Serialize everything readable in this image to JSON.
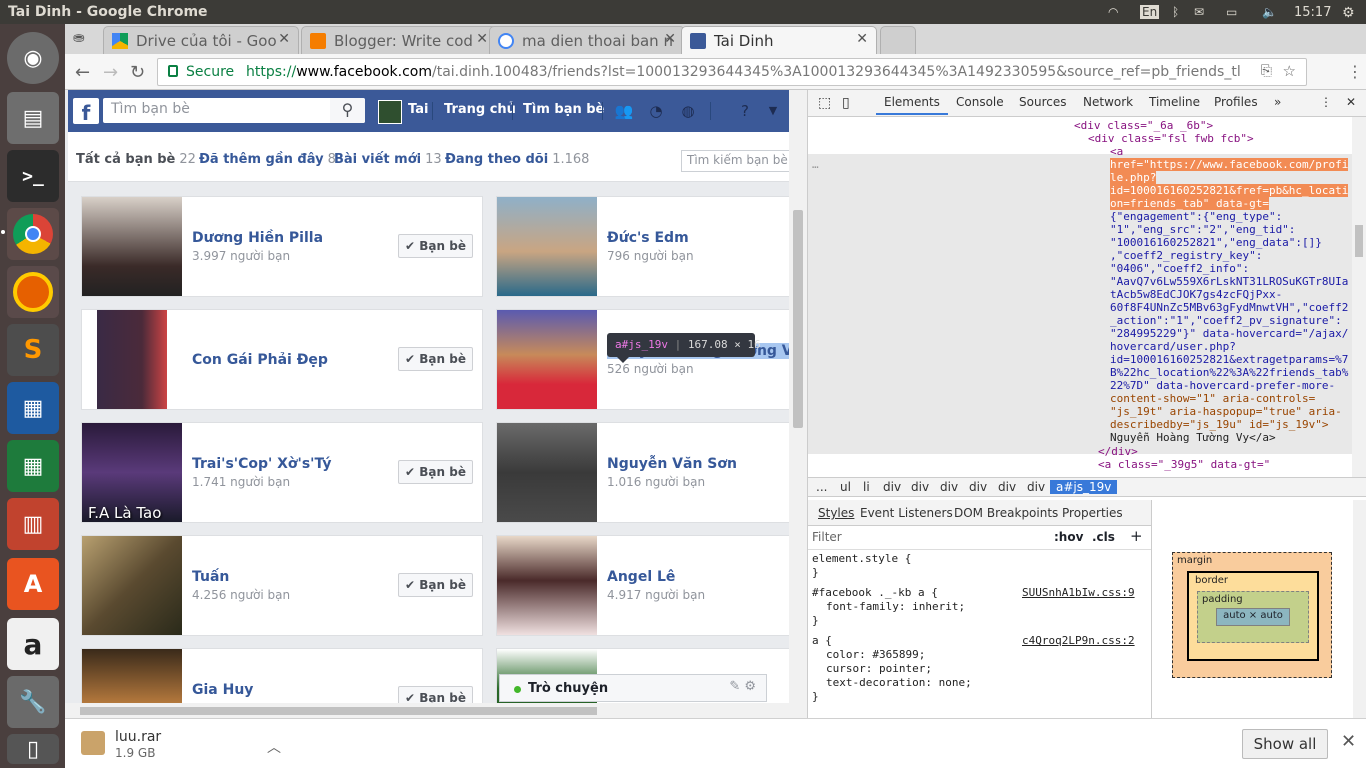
{
  "system": {
    "window_title": "Tai Dinh - Google Chrome",
    "kbd_layout": "En",
    "clock": "15:17"
  },
  "tabs": [
    {
      "label": "Drive của tôi - Goo",
      "active": false
    },
    {
      "label": "Blogger: Write cod",
      "active": false
    },
    {
      "label": "ma dien thoai ban n",
      "active": false
    },
    {
      "label": "Tai Dinh",
      "active": true
    }
  ],
  "omnibox": {
    "secure_label": "Secure",
    "url_scheme": "https://",
    "url_domain": "www.facebook.com",
    "url_path": "/tai.dinh.100483/friends?lst=100013293644345%3A100013293644345%3A1492330595&source_ref=pb_friends_tl"
  },
  "fb": {
    "search_placeholder": "Tìm bạn bè",
    "user_name": "Tai",
    "home_label": "Trang chủ",
    "find_friends_label": "Tìm bạn bè",
    "subnav": [
      {
        "label": "Tất cả bạn bè",
        "count": "22"
      },
      {
        "label": "Đã thêm gần đây",
        "count": "8"
      },
      {
        "label": "Bài viết mới",
        "count": "13"
      },
      {
        "label": "Đang theo dõi",
        "count": "1.168"
      }
    ],
    "friends_search_placeholder": "Tìm kiếm bạn bè",
    "friend_button": "Bạn bè",
    "friends": [
      {
        "name": "Dương Hiền Pilla",
        "count": "3.997 người bạn"
      },
      {
        "name": "Đức's Edm",
        "count": "796 người bạn"
      },
      {
        "name": "Con Gái Phải Đẹp",
        "count": ""
      },
      {
        "name": "Nguyễn Hoàng Tường Vy",
        "count": "526 người bạn"
      },
      {
        "name": "Trai's'Cop' Xờ's'Tý",
        "count": "1.741 người bạn"
      },
      {
        "name": "Nguyễn Văn Sơn",
        "count": "1.016 người bạn"
      },
      {
        "name": "Tuấn",
        "count": "4.256 người bạn"
      },
      {
        "name": "Angel Lê",
        "count": "4.917 người bạn"
      },
      {
        "name": "Gia Huy",
        "count": ""
      }
    ],
    "photo_caption": "F.A Là Tao",
    "chat_label": "Trò chuyện",
    "tooltip_tag": "a#js_19v",
    "tooltip_size": "167.08 × 16"
  },
  "devtools": {
    "tabs": [
      "Elements",
      "Console",
      "Sources",
      "Network",
      "Timeline",
      "Profiles"
    ],
    "dom_lines": [
      "<div class=\"_6a _6b\">",
      "<div class=\"fsl fwb fcb\">",
      "<a",
      "href=\"https://www.facebook.com/profi",
      "le.php?",
      "id=100016160252821&fref=pb&hc_locati",
      "on=friends_tab\" data-gt=",
      "{\"engagement\":{\"eng_type\":",
      "\"1\",\"eng_src\":\"2\",\"eng_tid\":",
      "\"100016160252821\",\"eng_data\":[]}",
      ",\"coeff2_registry_key\":",
      "\"0406\",\"coeff2_info\":",
      "\"AavQ7v6Lw559X6rLskNT31LROSuKGTr8UIa",
      "tAcb5w8EdCJOK7gs4zcFQjPxx-",
      "60f8F4UNnZc5MBv63gFydMnwtVH\",\"coeff2",
      "_action\":\"1\",\"coeff2_pv_signature\":",
      "\"284995229\"}\" data-hovercard=\"/ajax/",
      "hovercard/user.php?",
      "id=100016160252821&extragetparams=%7",
      "B%22hc_location%22%3A%22friends_tab%",
      "22%7D\" data-hovercard-prefer-more-",
      "content-show=\"1\" aria-controls=",
      "\"js_19t\" aria-haspopup=\"true\" aria-",
      "describedby=\"js_19u\" id=\"js_19v\">",
      "Nguyễn Hoàng Tường Vy</a>",
      "</div>",
      "<a class=\"_39g5\" data-gt=\""
    ],
    "crumbs": [
      "...",
      "ul",
      "li",
      "div",
      "div",
      "div",
      "div",
      "div",
      "div",
      "a#js_19v"
    ],
    "style_tabs": [
      "Styles",
      "Event Listeners",
      "DOM Breakpoints",
      "Properties"
    ],
    "filter_label": "Filter",
    "filter_hov": ":hov",
    "filter_cls": ".cls",
    "rules": [
      {
        "selector": "element.style {",
        "source": ""
      },
      {
        "selector": "#facebook ._-kb a {",
        "source": "SUUSnhA1bIw.css:9",
        "props": [
          "font-family: inherit;"
        ]
      },
      {
        "selector": "a {",
        "source": "c4Qroq2LP9n.css:2",
        "props": [
          "color: #365899;",
          "cursor: pointer;",
          "text-decoration: none;"
        ]
      }
    ],
    "box": {
      "margin": "margin",
      "border": "border",
      "padding": "padding",
      "content": "auto × auto",
      "dash": "–"
    }
  },
  "downloads": {
    "file": "luu.rar",
    "size": "1.9 GB",
    "show_all": "Show all"
  }
}
